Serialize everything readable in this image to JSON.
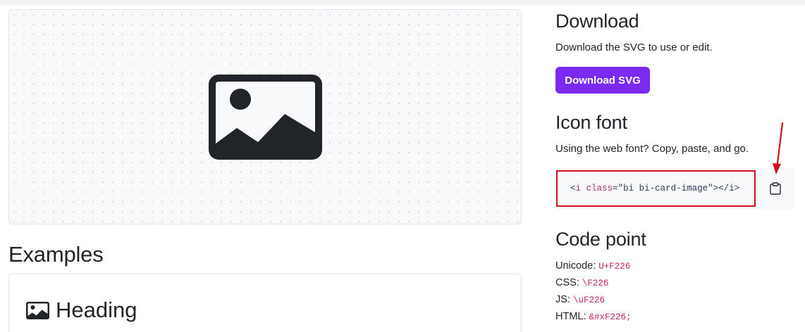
{
  "preview": {
    "icon": "card-image-icon"
  },
  "examples": {
    "title": "Examples",
    "heading_text": "Heading",
    "heading_icon": "card-image-icon"
  },
  "download": {
    "title": "Download",
    "description": "Download the SVG to use or edit.",
    "button_label": "Download SVG",
    "button_color": "#7a2af2"
  },
  "icon_font": {
    "title": "Icon font",
    "description": "Using the web font? Copy, paste, and go.",
    "code": {
      "open_bracket": "<",
      "tag": "i",
      "attr": "class",
      "equals": "=",
      "value": "\"bi bi-card-image\"",
      "close_open": ">",
      "closing_tag": "</i>"
    },
    "copy_icon": "clipboard-icon",
    "highlight_color": "#d5101d"
  },
  "code_point": {
    "title": "Code point",
    "rows": [
      {
        "label": "Unicode:",
        "value": "U+F226"
      },
      {
        "label": "CSS:",
        "value": "\\F226"
      },
      {
        "label": "JS:",
        "value": "\\uF226"
      },
      {
        "label": "HTML:",
        "value": "&#xF226;"
      }
    ],
    "code_color": "#c7245f"
  },
  "annotation": {
    "arrow_color": "#d5101d"
  }
}
